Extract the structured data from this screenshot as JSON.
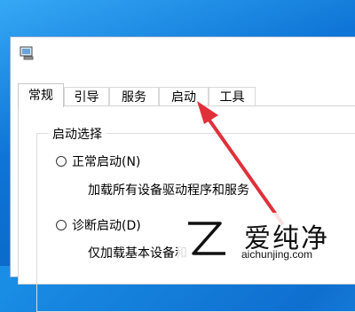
{
  "tabs": [
    {
      "label": "常规",
      "active": true
    },
    {
      "label": "引导",
      "active": false
    },
    {
      "label": "服务",
      "active": false
    },
    {
      "label": "启动",
      "active": false
    },
    {
      "label": "工具",
      "active": false
    }
  ],
  "startup_group": {
    "title": "启动选择",
    "options": [
      {
        "label": "正常启动(N)",
        "description": "加载所有设备驱动程序和服务",
        "selected": false
      },
      {
        "label": "诊断启动(D)",
        "description": "仅加载基本设备和",
        "selected": false
      }
    ]
  },
  "watermark": {
    "cn_text": "爱纯净",
    "url_text": "aichunjing.com"
  },
  "colors": {
    "desktop": "#0e75d6",
    "arrow": "#e0303a"
  },
  "icons": {
    "window": "msconfig-icon",
    "logo": "aichunjing-logo-icon"
  }
}
